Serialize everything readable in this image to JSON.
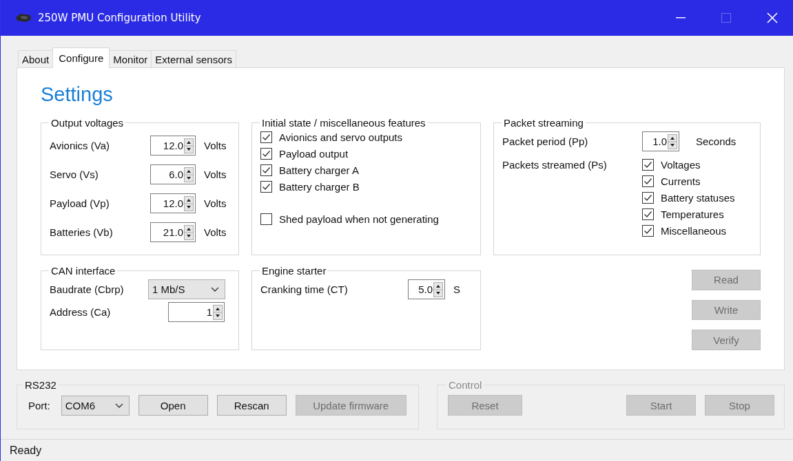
{
  "window": {
    "title": "250W PMU Configuration Utility",
    "maximize_disabled": true
  },
  "tabs": [
    {
      "label": "About",
      "selected": false
    },
    {
      "label": "Configure",
      "selected": true
    },
    {
      "label": "Monitor",
      "selected": false
    },
    {
      "label": "External sensors",
      "selected": false
    }
  ],
  "settings": {
    "heading": "Settings",
    "output_voltages": {
      "title": "Output voltages",
      "rows": [
        {
          "label": "Avionics (Va)",
          "value": "12.0",
          "unit": "Volts"
        },
        {
          "label": "Servo (Vs)",
          "value": "6.0",
          "unit": "Volts"
        },
        {
          "label": "Payload (Vp)",
          "value": "12.0",
          "unit": "Volts"
        },
        {
          "label": "Batteries (Vb)",
          "value": "21.0",
          "unit": "Volts"
        }
      ]
    },
    "initial_state": {
      "title": "Initial state / miscellaneous features",
      "options": [
        {
          "label": "Avionics and servo outputs",
          "checked": true
        },
        {
          "label": "Payload output",
          "checked": true
        },
        {
          "label": "Battery charger A",
          "checked": true
        },
        {
          "label": "Battery charger B",
          "checked": true
        }
      ],
      "extra_options": [
        {
          "label": "Shed payload when not generating",
          "checked": false
        }
      ]
    },
    "packet_streaming": {
      "title": "Packet streaming",
      "period": {
        "label": "Packet period (Pp)",
        "value": "1.0",
        "unit": "Seconds"
      },
      "streamed": {
        "label": "Packets streamed (Ps)",
        "options": [
          {
            "label": "Voltages",
            "checked": true
          },
          {
            "label": "Currents",
            "checked": true
          },
          {
            "label": "Battery statuses",
            "checked": true
          },
          {
            "label": "Temperatures",
            "checked": true
          },
          {
            "label": "Miscellaneous",
            "checked": true
          }
        ]
      }
    },
    "can_interface": {
      "title": "CAN interface",
      "baudrate": {
        "label": "Baudrate (Cbrp)",
        "value": "1 Mb/S"
      },
      "address": {
        "label": "Address (Ca)",
        "value": "1"
      }
    },
    "engine_starter": {
      "title": "Engine starter",
      "cranking": {
        "label": "Cranking time (CT)",
        "value": "5.0",
        "unit": "S"
      }
    },
    "actions": [
      {
        "label": "Read",
        "disabled": true
      },
      {
        "label": "Write",
        "disabled": true
      },
      {
        "label": "Verify",
        "disabled": true
      }
    ]
  },
  "rs232": {
    "title": "RS232",
    "port_label": "Port:",
    "port_value": "COM6",
    "buttons": [
      {
        "label": "Open",
        "disabled": false
      },
      {
        "label": "Rescan",
        "disabled": false
      },
      {
        "label": "Update firmware",
        "disabled": true
      }
    ]
  },
  "control": {
    "title": "Control",
    "disabled": true,
    "left_buttons": [
      {
        "label": "Reset",
        "disabled": true
      }
    ],
    "right_buttons": [
      {
        "label": "Start",
        "disabled": true
      },
      {
        "label": "Stop",
        "disabled": true
      }
    ]
  },
  "status_bar": {
    "text": "Ready"
  }
}
